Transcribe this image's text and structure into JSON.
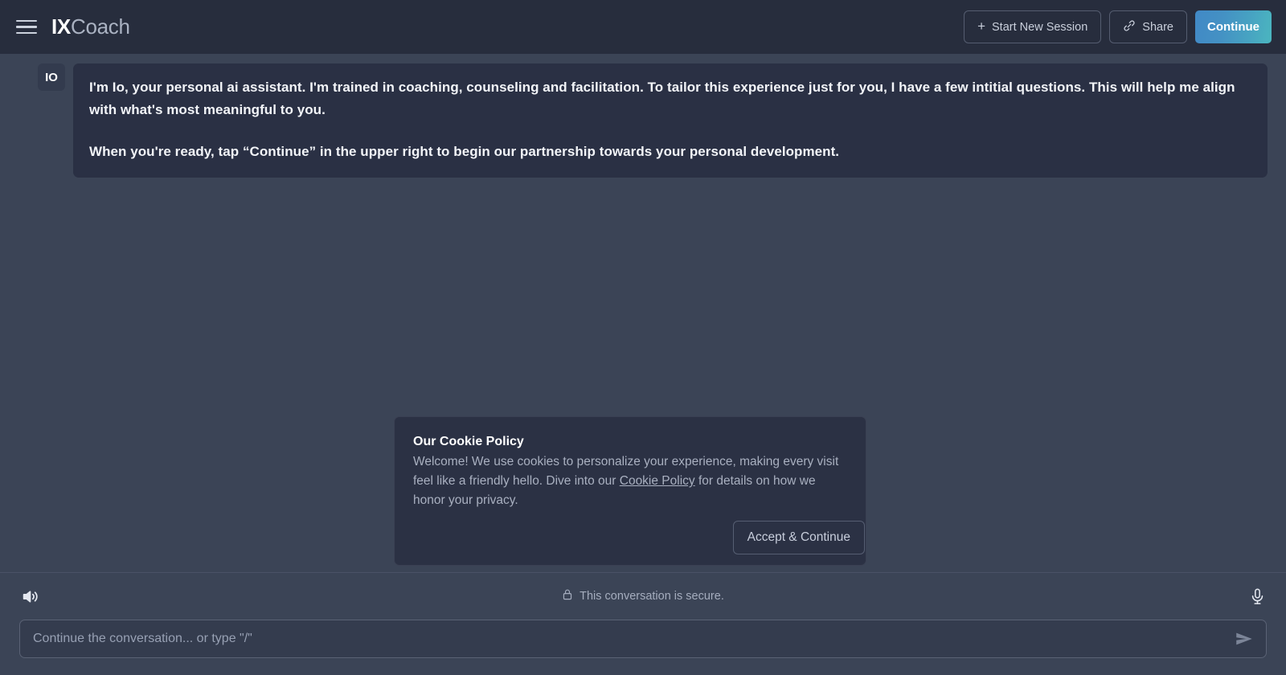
{
  "header": {
    "menu_icon": "hamburger-menu-icon",
    "brand_primary": "IX",
    "brand_secondary": "Coach",
    "new_session_label": "Start New Session",
    "new_session_icon": "plus-icon",
    "share_label": "Share",
    "share_icon": "link-icon",
    "continue_label": "Continue",
    "background": "#272d3d",
    "continue_gradient_start": "#4189c6",
    "continue_gradient_end": "#4bb6bf"
  },
  "chat": {
    "messages": [
      {
        "avatar": "IO",
        "paragraphs": [
          "I'm Io, your personal ai assistant. I'm trained in coaching, counseling and facilitation. To tailor this experience just for you, I have a few intitial questions. This will help me align with what's most meaningful to you.",
          "When you're ready, tap “Continue” in the upper right to begin our partnership towards your personal development."
        ]
      }
    ],
    "bubble_background": "#2a3044",
    "area_background": "#3b4456"
  },
  "cookie_dialog": {
    "title": "Our Cookie Policy",
    "body_before_link": "Welcome! We use cookies to personalize your experience, making every visit feel like a friendly hello. Dive into our ",
    "link_label": "Cookie Policy",
    "body_after_link": " for details on how we honor your privacy.",
    "accept_label": "Accept & Continue",
    "background": "#2b3144"
  },
  "bottom": {
    "speaker_icon": "speaker-volume-icon",
    "mic_icon": "microphone-icon",
    "secure_icon": "lock-icon",
    "secure_text": "This conversation is secure.",
    "composer_placeholder": "Continue the conversation... or type \"/\"",
    "composer_value": "",
    "send_icon": "send-paper-plane-icon"
  }
}
